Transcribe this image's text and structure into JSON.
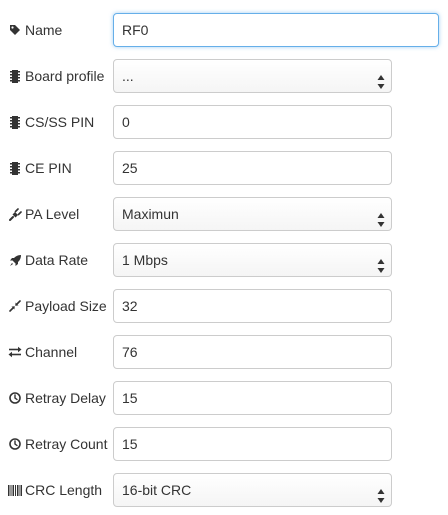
{
  "form": {
    "name": {
      "label": "Name",
      "value": "RF0",
      "icon": "tag-icon"
    },
    "board_profile": {
      "label": "Board profile",
      "value": "...",
      "icon": "chip-icon"
    },
    "cs_ss_pin": {
      "label": "CS/SS PIN",
      "value": "0",
      "icon": "chip-icon"
    },
    "ce_pin": {
      "label": "CE PIN",
      "value": "25",
      "icon": "chip-icon"
    },
    "pa_level": {
      "label": "PA Level",
      "value": "Maximun",
      "icon": "plug-icon"
    },
    "data_rate": {
      "label": "Data Rate",
      "value": "1 Mbps",
      "icon": "rocket-icon"
    },
    "payload_size": {
      "label": "Payload Size",
      "value": "32",
      "icon": "compress-icon"
    },
    "channel": {
      "label": "Channel",
      "value": "76",
      "icon": "exchange-icon"
    },
    "retray_delay": {
      "label": "Retray Delay",
      "value": "15",
      "icon": "clock-icon"
    },
    "retray_count": {
      "label": "Retray Count",
      "value": "15",
      "icon": "clock-icon"
    },
    "crc_length": {
      "label": "CRC Length",
      "value": "16-bit CRC",
      "icon": "barcode-icon"
    }
  },
  "colors": {
    "text": "#333333",
    "border": "#cccccc",
    "focus_border": "#66afe9"
  }
}
